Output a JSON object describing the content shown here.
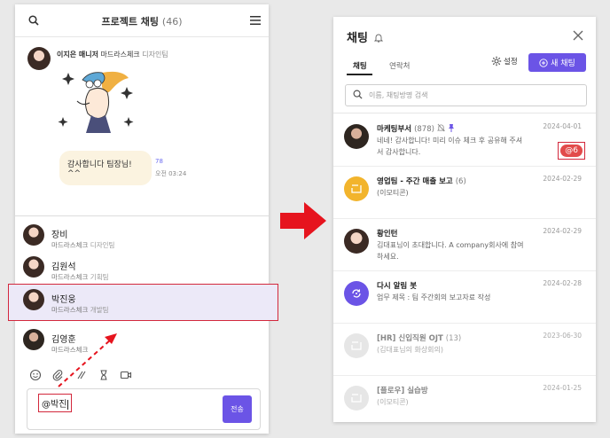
{
  "left": {
    "title": "프로젝트 채팅",
    "count": "(46)",
    "message": {
      "sender_name": "이지은 매니저",
      "sender_dept": "마드라스체크",
      "sender_team": "디자인팀",
      "bubble": "감사합니다 팀장님! ^^",
      "read_count": "78",
      "time": "오전 03:24"
    },
    "mentions": [
      {
        "name": "장비",
        "dept": "마드라스체크",
        "team": "디자인팀"
      },
      {
        "name": "김원석",
        "dept": "마드라스체크",
        "team": "기획팀"
      },
      {
        "name": "박진웅",
        "dept": "마드라스체크",
        "team": "개발팀"
      },
      {
        "name": "김영훈",
        "dept": "마드라스체크",
        "team": ""
      }
    ],
    "composer_value": "@박진",
    "send_label": "전송"
  },
  "right": {
    "title": "채팅",
    "tabs": [
      "채팅",
      "연락처"
    ],
    "settings_label": "설정",
    "new_chat_label": "새 채팅",
    "search_placeholder": "이름, 채팅방명 검색",
    "chats": [
      {
        "name": "마케팅부서",
        "count": "(878)",
        "preview": "네네! 감사합니다! 미리 이슈 체크 후 공유해 주셔서 감사합니다.",
        "date": "2024-04-01",
        "badge": "@6"
      },
      {
        "name": "영업팀 - 주간 매출 보고",
        "count": "(6)",
        "preview": "(이모티콘)",
        "date": "2024-02-29"
      },
      {
        "name": "황인턴",
        "count": "",
        "preview": "김대표님이 초대합니다. A company회사에 참여하세요.",
        "date": "2024-02-29"
      },
      {
        "name": "다시 알림 봇",
        "count": "",
        "preview": "업무 제목 : 팀 주간회의 보고자료 작성",
        "date": "2024-02-28"
      },
      {
        "name": "[HR] 신입직원 OJT",
        "count": "(13)",
        "preview": "(김대표님의 화상회의)",
        "date": "2023-06-30"
      },
      {
        "name": "[플로우] 실습방",
        "count": "",
        "preview": "(이모티콘)",
        "date": "2024-01-25"
      }
    ]
  },
  "colors": {
    "accent": "#6b54e6",
    "highlight_border": "#d3283c",
    "badge": "#e24b4b",
    "arrow": "#e6141e"
  }
}
